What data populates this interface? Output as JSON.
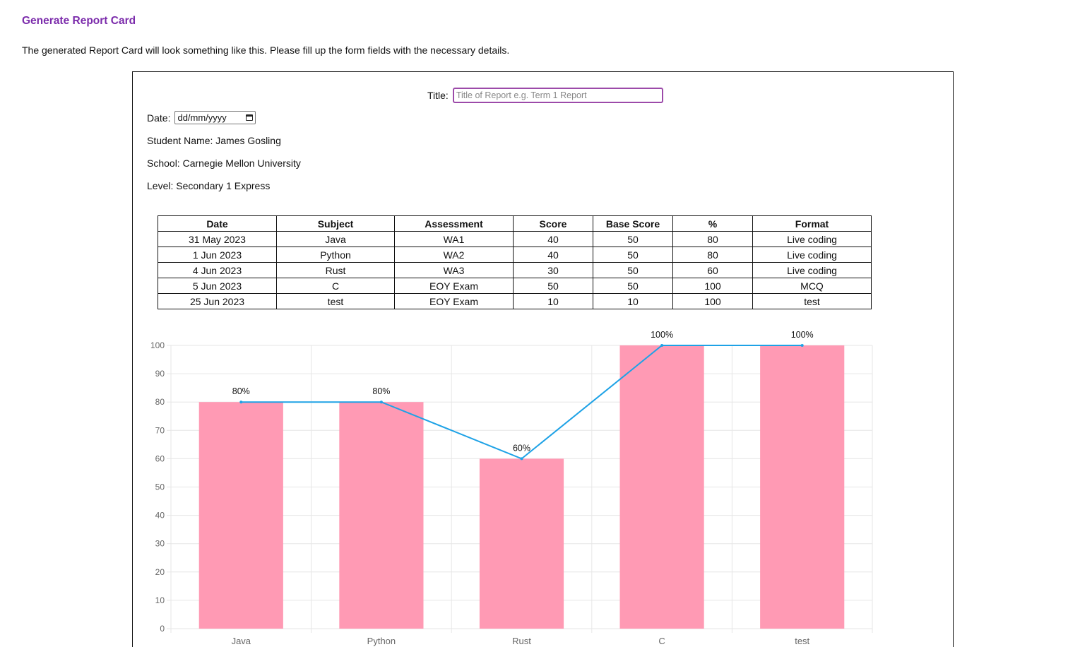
{
  "heading": "Generate Report Card",
  "intro": "The generated Report Card will look something like this. Please fill up the form fields with the necessary details.",
  "form": {
    "title_label": "Title:",
    "title_placeholder": "Title of Report e.g. Term 1 Report",
    "date_label": "Date:",
    "date_value": "dd/mm/yyyy",
    "student_name": "Student Name: James Gosling",
    "school": "School: Carnegie Mellon University",
    "level": "Level: Secondary 1 Express"
  },
  "table": {
    "headers": [
      "Date",
      "Subject",
      "Assessment",
      "Score",
      "Base Score",
      "%",
      "Format"
    ],
    "rows": [
      [
        "31 May 2023",
        "Java",
        "WA1",
        "40",
        "50",
        "80",
        "Live coding"
      ],
      [
        "1 Jun 2023",
        "Python",
        "WA2",
        "40",
        "50",
        "80",
        "Live coding"
      ],
      [
        "4 Jun 2023",
        "Rust",
        "WA3",
        "30",
        "50",
        "60",
        "Live coding"
      ],
      [
        "5 Jun 2023",
        "C",
        "EOY Exam",
        "50",
        "50",
        "100",
        "MCQ"
      ],
      [
        "25 Jun 2023",
        "test",
        "EOY Exam",
        "10",
        "10",
        "100",
        "test"
      ]
    ]
  },
  "chart_data": {
    "type": "bar",
    "categories": [
      "Java",
      "Python",
      "Rust",
      "C",
      "test"
    ],
    "series": [
      {
        "values": [
          80,
          80,
          60,
          100,
          100
        ],
        "render": "bar",
        "color": "#ff9ab4"
      },
      {
        "values": [
          80,
          80,
          60,
          100,
          100
        ],
        "render": "line",
        "color": "#1ea2e6"
      }
    ],
    "data_labels": [
      "80%",
      "80%",
      "60%",
      "100%",
      "100%"
    ],
    "ylim": [
      0,
      100
    ],
    "yticks": [
      0,
      10,
      20,
      30,
      40,
      50,
      60,
      70,
      80,
      90,
      100
    ],
    "grid": true
  }
}
